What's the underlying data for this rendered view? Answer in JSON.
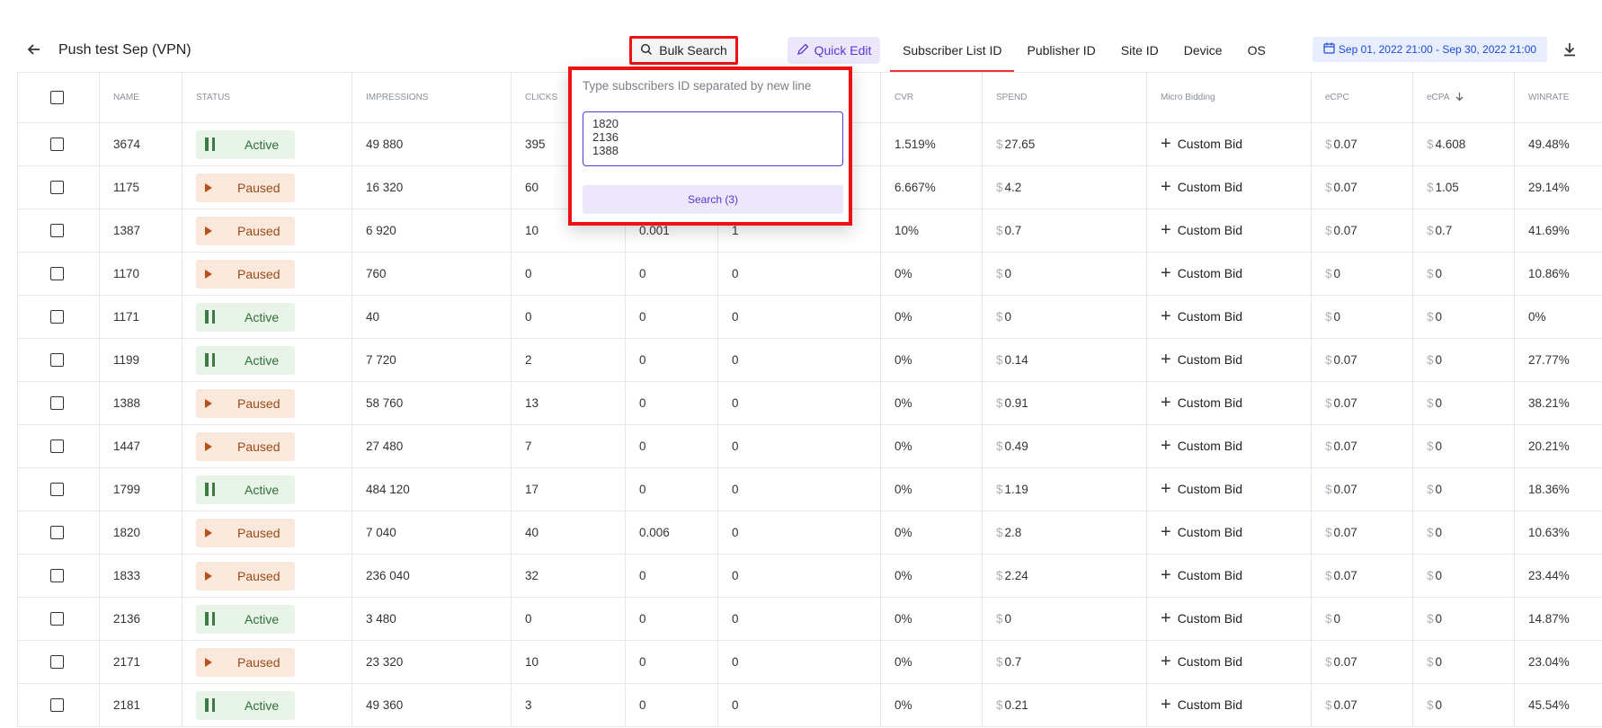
{
  "header": {
    "title": "Push test Sep (VPN)",
    "bulk_search_label": "Bulk Search",
    "quick_edit_label": "Quick Edit",
    "tabs": [
      "Subscriber List ID",
      "Publisher ID",
      "Site ID",
      "Device",
      "OS"
    ],
    "active_tab": "Subscriber List ID",
    "date_range": "Sep 01, 2022 21:00 - Sep 30, 2022 21:00"
  },
  "table": {
    "columns": [
      "NAME",
      "STATUS",
      "IMPRESSIONS",
      "CLICKS",
      "",
      "",
      "CVR",
      "SPEND",
      "Micro Bidding",
      "eCPC",
      "eCPA",
      "WINRATE"
    ],
    "sorted_column": "eCPA",
    "custom_bid_label": "Custom Bid",
    "rows": [
      {
        "name": "3674",
        "status": "Active",
        "impressions": "49 880",
        "clicks": "395",
        "c5": "",
        "c6": "",
        "cvr": "1.519%",
        "spend": "27.65",
        "ecpc": "0.07",
        "ecpa": "4.608",
        "winrate": "49.48%"
      },
      {
        "name": "1175",
        "status": "Paused",
        "impressions": "16 320",
        "clicks": "60",
        "c5": "",
        "c6": "",
        "cvr": "6.667%",
        "spend": "4.2",
        "ecpc": "0.07",
        "ecpa": "1.05",
        "winrate": "29.14%"
      },
      {
        "name": "1387",
        "status": "Paused",
        "impressions": "6 920",
        "clicks": "10",
        "c5": "0.001",
        "c6": "1",
        "cvr": "10%",
        "spend": "0.7",
        "ecpc": "0.07",
        "ecpa": "0.7",
        "winrate": "41.69%"
      },
      {
        "name": "1170",
        "status": "Paused",
        "impressions": "760",
        "clicks": "0",
        "c5": "0",
        "c6": "0",
        "cvr": "0%",
        "spend": "0",
        "ecpc": "0",
        "ecpa": "0",
        "winrate": "10.86%"
      },
      {
        "name": "1171",
        "status": "Active",
        "impressions": "40",
        "clicks": "0",
        "c5": "0",
        "c6": "0",
        "cvr": "0%",
        "spend": "0",
        "ecpc": "0",
        "ecpa": "0",
        "winrate": "0%"
      },
      {
        "name": "1199",
        "status": "Active",
        "impressions": "7 720",
        "clicks": "2",
        "c5": "0",
        "c6": "0",
        "cvr": "0%",
        "spend": "0.14",
        "ecpc": "0.07",
        "ecpa": "0",
        "winrate": "27.77%"
      },
      {
        "name": "1388",
        "status": "Paused",
        "impressions": "58 760",
        "clicks": "13",
        "c5": "0",
        "c6": "0",
        "cvr": "0%",
        "spend": "0.91",
        "ecpc": "0.07",
        "ecpa": "0",
        "winrate": "38.21%"
      },
      {
        "name": "1447",
        "status": "Paused",
        "impressions": "27 480",
        "clicks": "7",
        "c5": "0",
        "c6": "0",
        "cvr": "0%",
        "spend": "0.49",
        "ecpc": "0.07",
        "ecpa": "0",
        "winrate": "20.21%"
      },
      {
        "name": "1799",
        "status": "Active",
        "impressions": "484 120",
        "clicks": "17",
        "c5": "0",
        "c6": "0",
        "cvr": "0%",
        "spend": "1.19",
        "ecpc": "0.07",
        "ecpa": "0",
        "winrate": "18.36%"
      },
      {
        "name": "1820",
        "status": "Paused",
        "impressions": "7 040",
        "clicks": "40",
        "c5": "0.006",
        "c6": "0",
        "cvr": "0%",
        "spend": "2.8",
        "ecpc": "0.07",
        "ecpa": "0",
        "winrate": "10.63%"
      },
      {
        "name": "1833",
        "status": "Paused",
        "impressions": "236 040",
        "clicks": "32",
        "c5": "0",
        "c6": "0",
        "cvr": "0%",
        "spend": "2.24",
        "ecpc": "0.07",
        "ecpa": "0",
        "winrate": "23.44%"
      },
      {
        "name": "2136",
        "status": "Active",
        "impressions": "3 480",
        "clicks": "0",
        "c5": "0",
        "c6": "0",
        "cvr": "0%",
        "spend": "0",
        "ecpc": "0",
        "ecpa": "0",
        "winrate": "14.87%"
      },
      {
        "name": "2171",
        "status": "Paused",
        "impressions": "23 320",
        "clicks": "10",
        "c5": "0",
        "c6": "0",
        "cvr": "0%",
        "spend": "0.7",
        "ecpc": "0.07",
        "ecpa": "0",
        "winrate": "23.04%"
      },
      {
        "name": "2181",
        "status": "Active",
        "impressions": "49 360",
        "clicks": "3",
        "c5": "0",
        "c6": "0",
        "cvr": "0%",
        "spend": "0.21",
        "ecpc": "0.07",
        "ecpa": "0",
        "winrate": "45.54%"
      }
    ]
  },
  "bulk_search_popup": {
    "hint": "Type subscribers ID separated by new line",
    "textarea_value": "1820\n2136\n1388",
    "search_button_label": "Search (3)"
  },
  "icons": {
    "back": "arrow-left-icon",
    "bulk_search": "search-icon",
    "quick_edit": "pencil-icon",
    "date": "calendar-icon",
    "download": "download-icon",
    "active_status": "pause-icon",
    "paused_status": "play-icon",
    "custom_bid": "plus-icon",
    "sort": "arrow-down-icon"
  },
  "colors": {
    "highlight_border": "#ee1111",
    "accent_purple": "#5a35d6",
    "active_bg": "#e7f4e7",
    "paused_bg": "#fbe8dc",
    "date_text": "#1e4bd8"
  }
}
